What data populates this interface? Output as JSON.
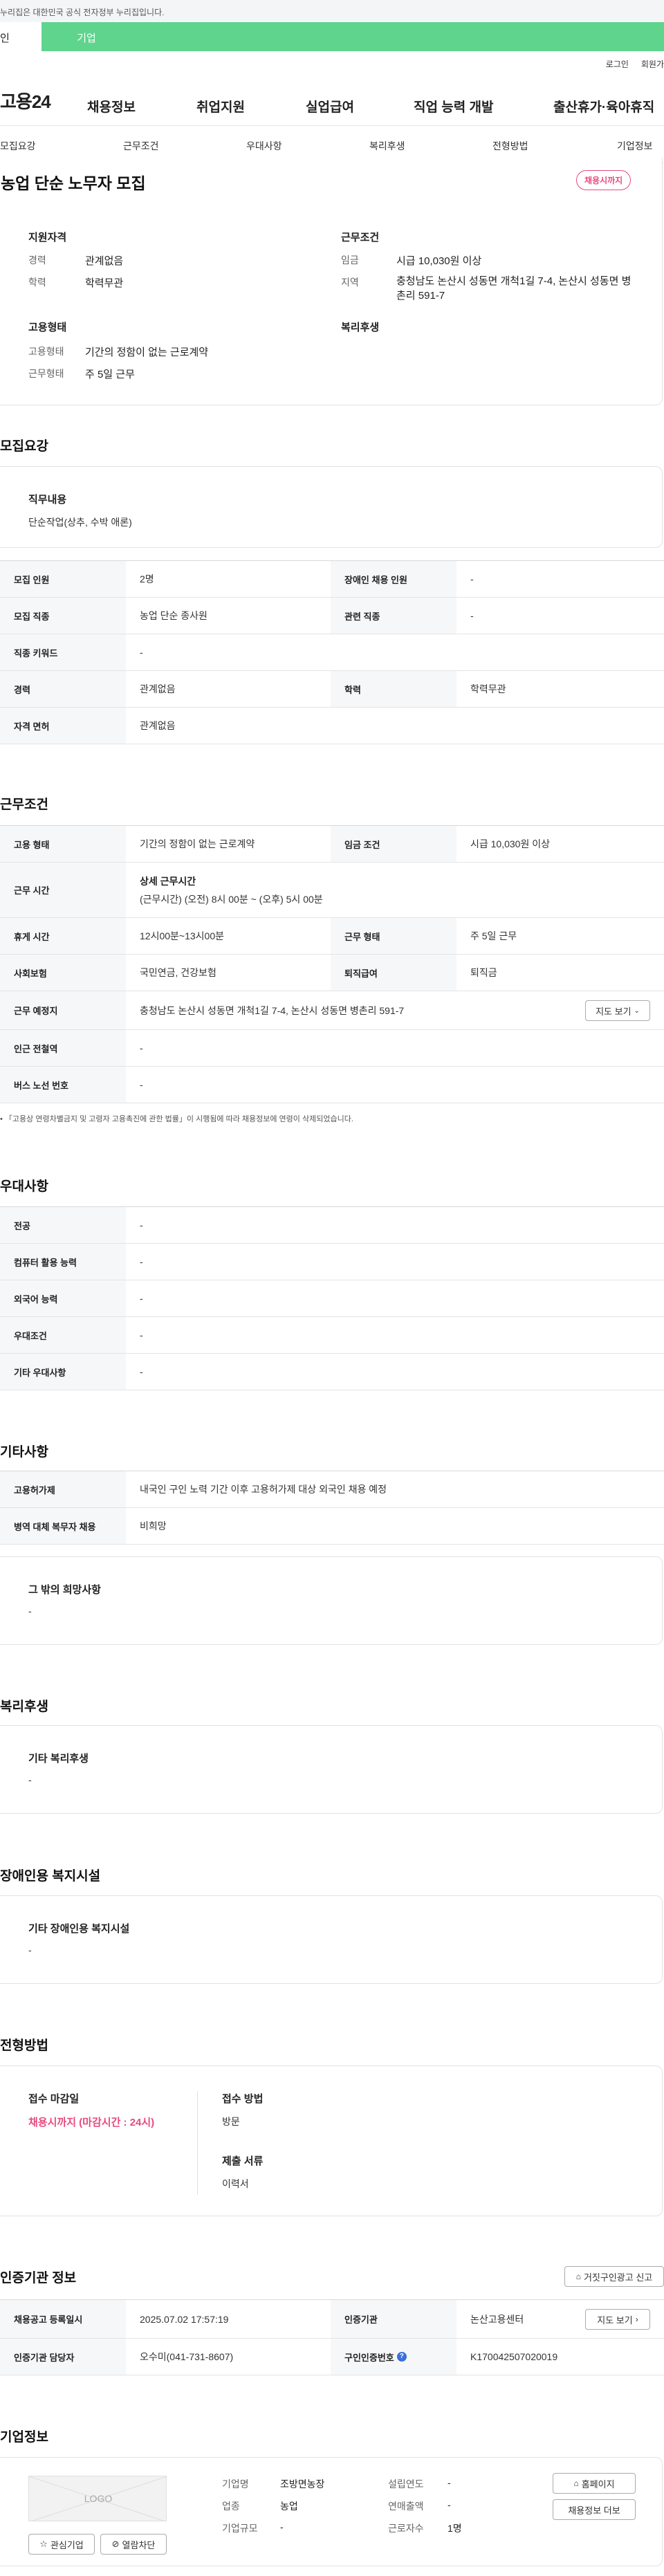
{
  "gov_bar": {
    "text": "누리집은 대한민국 공식 전자정부 누리집입니다."
  },
  "top_tabs": {
    "person": "인",
    "corporate": "기업"
  },
  "util_links": {
    "login": "로그인",
    "join": "회원가"
  },
  "header": {
    "logo": "고용24",
    "menu": [
      "채용정보",
      "취업지원",
      "실업급여",
      "직업 능력 개발",
      "출산휴가·육아휴직"
    ]
  },
  "subnav": [
    "모집요강",
    "근무조건",
    "우대사항",
    "복리후생",
    "전형방법",
    "기업정보"
  ],
  "summary": {
    "title": "농업 단순 노무자 모집",
    "badge": "채용시까지",
    "qualifications": {
      "heading": "지원자격",
      "rows": [
        {
          "label": "경력",
          "value": "관계없음"
        },
        {
          "label": "학력",
          "value": "학력무관"
        }
      ]
    },
    "conditions": {
      "heading": "근무조건",
      "rows": [
        {
          "label": "임금",
          "value": "시급 10,030원 이상"
        },
        {
          "label": "지역",
          "value": "충청남도 논산시 성동면 개척1길 7-4, 논산시 성동면 병촌리 591-7"
        }
      ]
    },
    "employment": {
      "heading": "고용형태",
      "rows": [
        {
          "label": "고용형태",
          "value": "기간의 정함이 없는 근로계약"
        },
        {
          "label": "근무형태",
          "value": "주 5일 근무"
        }
      ]
    },
    "welfare_heading": "복리후생"
  },
  "recruit": {
    "title": "모집요강",
    "job_desc_label": "직무내용",
    "job_desc": "단순작업(상추, 수박 애론)",
    "table": [
      {
        "h1": "모집 인원",
        "v1": "2명",
        "h2": "장애인 채용 인원",
        "v2": "-"
      },
      {
        "h1": "모집 직종",
        "v1": "농업 단순 종사원",
        "h2": "관련 직종",
        "v2": "-"
      },
      {
        "h1": "직종 키워드",
        "v1": "-"
      },
      {
        "h1": "경력",
        "v1": "관계없음",
        "h2": "학력",
        "v2": "학력무관"
      },
      {
        "h1": "자격 면허",
        "v1": "관계없음"
      }
    ]
  },
  "work": {
    "title": "근무조건",
    "r1": {
      "h1": "고용 형태",
      "v1": "기간의 정함이 없는 근로계약",
      "h2": "임금 조건",
      "v2": "시급 10,030원 이상"
    },
    "r2": {
      "h1": "근무 시간",
      "line1": "상세 근무시간",
      "line2": "(근무시간) (오전) 8시 00분 ~ (오후) 5시 00분"
    },
    "r3": {
      "h1": "휴게 시간",
      "v1": "12시00분~13시00분",
      "h2": "근무 형태",
      "v2": "주 5일 근무"
    },
    "r4": {
      "h1": "사회보험",
      "v1": "국민연금, 건강보험",
      "h2": "퇴직급여",
      "v2": "퇴직금"
    },
    "r5": {
      "h1": "근무 예정지",
      "v1": "충청남도 논산시 성동면 개척1길 7-4, 논산시 성동면 병촌리 591-7",
      "button": "지도 보기"
    },
    "r6": {
      "h1": "인근 전철역",
      "v1": "-"
    },
    "r7": {
      "h1": "버스 노선 번호",
      "v1": "-"
    },
    "note": "「고용상 연령차별금지 및 고령자 고용촉진에 관한 법률」이 시행됨에 따라 채용정보에 연령이 삭제되었습니다."
  },
  "prefer": {
    "title": "우대사항",
    "rows": [
      {
        "h": "전공",
        "v": "-"
      },
      {
        "h": "컴퓨터 활용 능력",
        "v": "-"
      },
      {
        "h": "외국어 능력",
        "v": "-"
      },
      {
        "h": "우대조건",
        "v": "-"
      },
      {
        "h": "기타 우대사항",
        "v": "-"
      }
    ]
  },
  "etc": {
    "title": "기타사항",
    "rows": [
      {
        "h": "고용허가제",
        "v": "내국인 구인 노력 기간 이후 고용허가제 대상 외국인 채용 예정"
      },
      {
        "h": "병역 대체 복무자 채용",
        "v": "비희망"
      }
    ],
    "card_label": "그 밖의 희망사항",
    "card_value": "-"
  },
  "welfare": {
    "title": "복리후생",
    "card_label": "기타 복리후생",
    "card_value": "-"
  },
  "disabled": {
    "title": "장애인용 복지시설",
    "card_label": "기타 장애인용 복지시설",
    "card_value": "-"
  },
  "selection": {
    "title": "전형방법",
    "deadline_label": "접수 마감일",
    "deadline_value": "채용시까지 (마감시간 : 24시)",
    "method_label": "접수 방법",
    "method_value": "방문",
    "docs_label": "제출 서류",
    "docs_value": "이력서"
  },
  "agency": {
    "title": "인증기관 정보",
    "report_button": "거짓구인광고 신고",
    "r1": {
      "h1": "채용공고 등록일시",
      "v1": "2025.07.02 17:57:19",
      "h2": "인증기관",
      "v2": "논산고용센터",
      "button": "지도 보기"
    },
    "r2": {
      "h1": "인증기관 담당자",
      "v1": "오수미(041-731-8607)",
      "h2": "구인인증번호",
      "v2": "K170042507020019"
    }
  },
  "company": {
    "title": "기업정보",
    "logo_text": "LOGO",
    "fav_button": "관심기업",
    "block_button": "열람차단",
    "fields": [
      {
        "label": "기업명",
        "value": "조방면농장"
      },
      {
        "label": "업종",
        "value": "농업"
      },
      {
        "label": "기업규모",
        "value": "-"
      },
      {
        "label": "설립연도",
        "value": "-"
      },
      {
        "label": "연매출액",
        "value": "-"
      },
      {
        "label": "근로자수",
        "value": "1명"
      }
    ],
    "home_button": "홈페이지",
    "jobs_button": "채용정보 더보"
  },
  "colors": {
    "green": "#5fd48d",
    "pink": "#e84a7f",
    "blue": "#3c6fd8"
  }
}
